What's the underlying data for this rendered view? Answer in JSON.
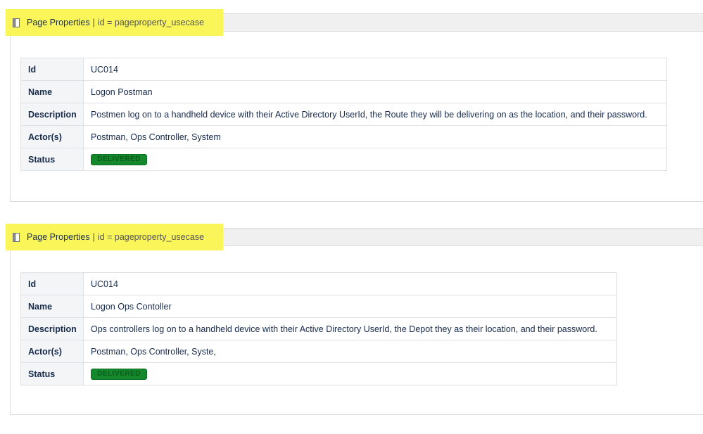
{
  "blocks": [
    {
      "macro_name": "Page Properties",
      "separator": "|",
      "macro_param": "id = pageproperty_usecase",
      "rows": [
        {
          "key": "Id",
          "value": "UC014"
        },
        {
          "key": "Name",
          "value": "Logon Postman"
        },
        {
          "key": "Description",
          "value": "Postmen log on to a handheld device with their Active Directory UserId, the Route they will be delivering on as the location, and their password."
        },
        {
          "key": "Actor(s)",
          "value": "Postman, Ops Controller, System"
        }
      ],
      "status_key": "Status",
      "status_value": "DELIVERED"
    },
    {
      "macro_name": "Page Properties",
      "separator": "|",
      "macro_param": "id = pageproperty_usecase",
      "rows": [
        {
          "key": "Id",
          "value": "UC014"
        },
        {
          "key": "Name",
          "value": "Logon Ops Contoller"
        },
        {
          "key": "Description",
          "value": "Ops controllers log on to a handheld device with their Active Directory UserId, the Depot they as their location, and their password."
        },
        {
          "key": "Actor(s)",
          "value": "Postman, Ops Controller, Syste,"
        }
      ],
      "status_key": "Status",
      "status_value": "DELIVERED"
    }
  ],
  "colors": {
    "highlight": "#faf65a",
    "status_green": "#14892c",
    "key_bg": "#f4f5f7"
  },
  "icons": {
    "macro": "page-properties-icon"
  }
}
